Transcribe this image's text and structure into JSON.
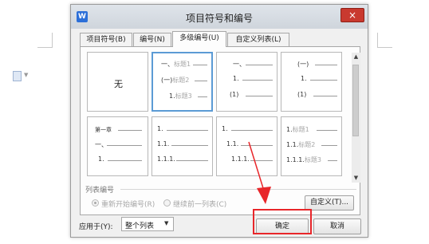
{
  "dialog": {
    "app_icon": "W",
    "title": "项目符号和编号",
    "close_symbol": "×",
    "tabs": [
      {
        "label": "项目符号(B)",
        "active": false
      },
      {
        "label": "编号(N)",
        "active": false
      },
      {
        "label": "多级编号(U)",
        "active": true
      },
      {
        "label": "自定义列表(L)",
        "active": false
      }
    ],
    "gallery": {
      "none_label": "无",
      "cells": [
        {
          "levels": [
            "一、标题1",
            "(一)标题2",
            "1.标题3"
          ]
        },
        {
          "levels": [
            "一、",
            "1.",
            "(1)"
          ]
        },
        {
          "levels": [
            "(一)",
            "1.",
            "(1)"
          ]
        },
        {
          "levels": [
            "第一章",
            "一、",
            "1."
          ]
        },
        {
          "levels": [
            "1.",
            "1.1.",
            "1.1.1."
          ]
        },
        {
          "levels": [
            "1.",
            "1.1.",
            "1.1.1."
          ]
        },
        {
          "levels": [
            "1.标题1",
            "1.1.标题2",
            "1.1.1.标题3"
          ]
        }
      ]
    },
    "list_numbering": {
      "label": "列表编号",
      "option_restart": "重新开始编号(R)",
      "option_continue": "继续前一列表(C)",
      "selected": "option_restart",
      "custom_button": "自定义(T)..."
    },
    "apply_to": {
      "label": "应用于(Y):",
      "value": "整个列表"
    },
    "ok_button": "确定",
    "cancel_button": "取消"
  },
  "annotation": {
    "color": "#e8262a",
    "arrow_icon": "arrow-icon"
  }
}
